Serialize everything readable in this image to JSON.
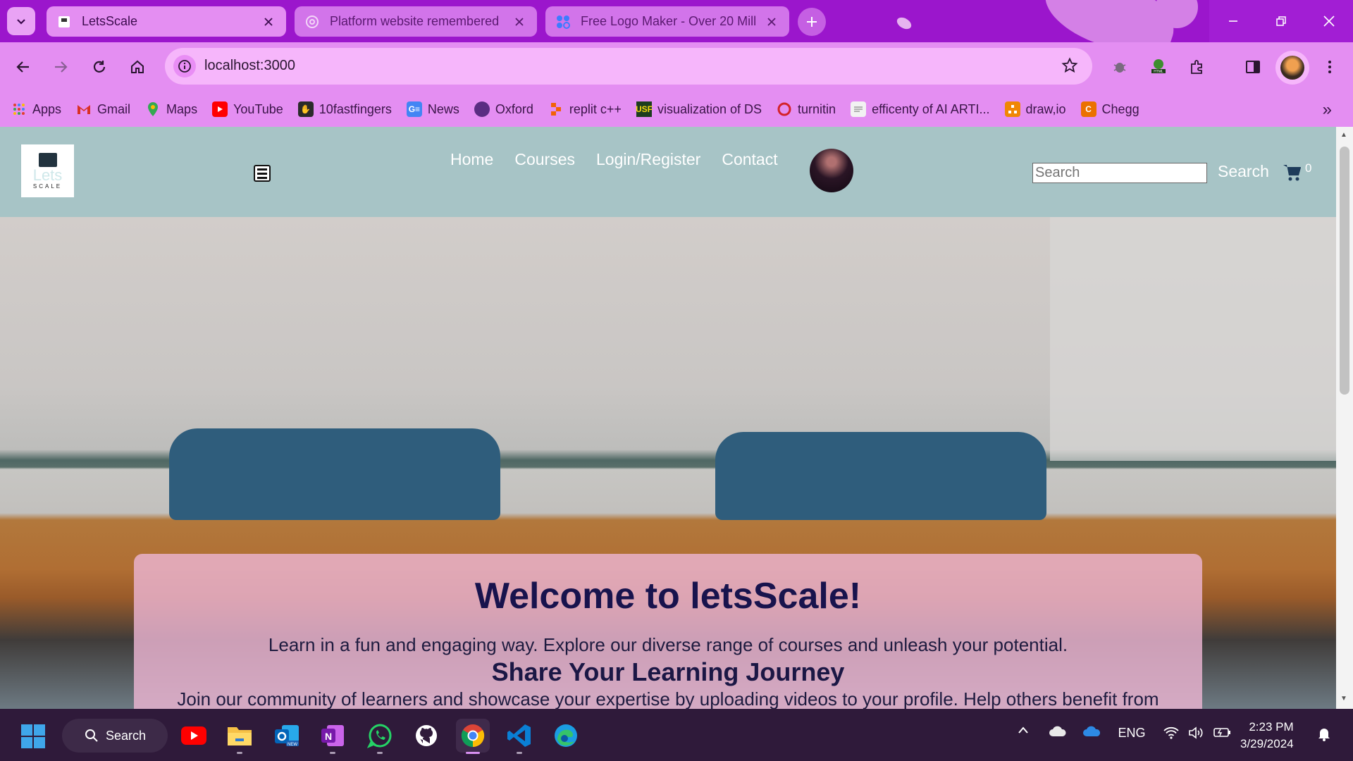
{
  "browser": {
    "tabs": [
      {
        "title": "LetsScale",
        "active": true,
        "favicon": "page-icon"
      },
      {
        "title": "Platform website remembered",
        "active": false,
        "favicon": "chatgpt-icon"
      },
      {
        "title": "Free Logo Maker - Over 20 Mill",
        "active": false,
        "favicon": "logo-maker-icon"
      }
    ],
    "url": "localhost:3000",
    "bookmarks": [
      {
        "label": "Apps",
        "icon": "apps-grid-icon",
        "color": "#e0402e"
      },
      {
        "label": "Gmail",
        "icon": "gmail-icon",
        "color": "#d93025"
      },
      {
        "label": "Maps",
        "icon": "maps-icon",
        "color": "#34a853"
      },
      {
        "label": "YouTube",
        "icon": "youtube-icon",
        "color": "#ff0000"
      },
      {
        "label": "10fastfingers",
        "icon": "tenfastfingers-icon",
        "color": "#2b2b2b"
      },
      {
        "label": "News",
        "icon": "google-news-icon",
        "color": "#4285f4"
      },
      {
        "label": "Oxford",
        "icon": "oxford-icon",
        "color": "#5a2d82"
      },
      {
        "label": "replit c++",
        "icon": "replit-icon",
        "color": "#f26207"
      },
      {
        "label": "visualization of DS",
        "icon": "usf-icon",
        "color": "#1d3d1d"
      },
      {
        "label": "turnitin",
        "icon": "turnitin-icon",
        "color": "#d4222a"
      },
      {
        "label": "efficenty of AI ARTI...",
        "icon": "document-icon",
        "color": "#bbbbbb"
      },
      {
        "label": "draw,io",
        "icon": "drawio-icon",
        "color": "#f08705"
      },
      {
        "label": "Chegg",
        "icon": "chegg-icon",
        "color": "#eb7100"
      }
    ]
  },
  "site": {
    "logo_word": "Lets",
    "logo_sub": "SCALE",
    "nav": [
      "Home",
      "Courses",
      "Login/Register",
      "Contact"
    ],
    "search_placeholder": "Search",
    "search_button": "Search",
    "cart_count": "0"
  },
  "hero": {
    "title": "Welcome to letsScale!",
    "lead": "Learn in a fun and engaging way. Explore our diverse range of courses and unleash your potential.",
    "subtitle": "Share Your Learning Journey",
    "body": "Join our community of learners and showcase your expertise by uploading videos to your profile. Help others benefit from"
  },
  "taskbar": {
    "search_label": "Search",
    "apps": [
      "youtube-icon",
      "file-explorer-icon",
      "outlook-icon",
      "onenote-icon",
      "whatsapp-icon",
      "github-icon",
      "chrome-icon",
      "vscode-icon",
      "edge-icon"
    ],
    "active_app": "chrome-icon",
    "language": "ENG",
    "time": "2:23 PM",
    "date": "3/29/2024"
  },
  "colors": {
    "tabstrip": "#9b16cc",
    "toolbar": "#e48ef2",
    "site_header": "#a7c4c6",
    "hero_title": "#18134d",
    "taskbar": "#2f1a3a"
  }
}
